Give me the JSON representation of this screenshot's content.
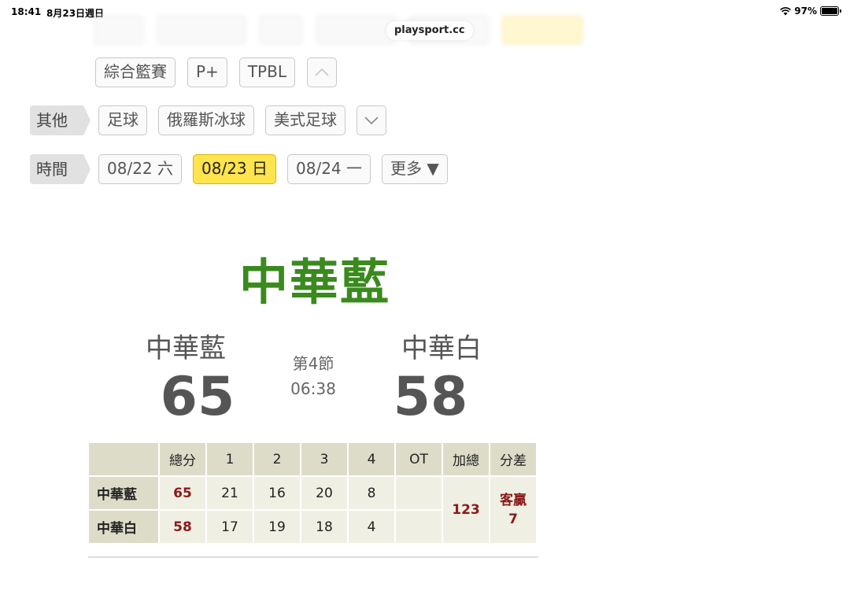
{
  "status_bar": {
    "time": "18:41",
    "date": "8月23日週日",
    "battery": "97%",
    "url": "playsport.cc"
  },
  "basketball_row": {
    "buttons": [
      "綜合籃賽",
      "P+",
      "TPBL"
    ]
  },
  "other_row": {
    "tag": "其他",
    "buttons": [
      "足球",
      "俄羅斯冰球",
      "美式足球"
    ]
  },
  "time_row": {
    "tag": "時間",
    "dates": [
      "08/22 六",
      "08/23 日",
      "08/24 一"
    ],
    "active_index": 1,
    "more": "更多 ▼"
  },
  "match": {
    "title": "中華藍",
    "home": {
      "name": "中華藍",
      "score": "65"
    },
    "away": {
      "name": "中華白",
      "score": "58"
    },
    "period": "第4節",
    "clock": "06:38"
  },
  "score_table": {
    "headers": [
      "",
      "總分",
      "1",
      "2",
      "3",
      "4",
      "OT",
      "加總",
      "分差"
    ],
    "rows": [
      {
        "team": "中華藍",
        "total": "65",
        "q": [
          "21",
          "16",
          "20",
          "8"
        ],
        "ot": ""
      },
      {
        "team": "中華白",
        "total": "58",
        "q": [
          "17",
          "19",
          "18",
          "4"
        ],
        "ot": ""
      }
    ],
    "sum": "123",
    "diff_label": "客贏",
    "diff_value": "7"
  },
  "colors": {
    "title_green": "#3a8a1e",
    "active_yellow": "#ffe44d",
    "score_red": "#8b1a1a"
  }
}
